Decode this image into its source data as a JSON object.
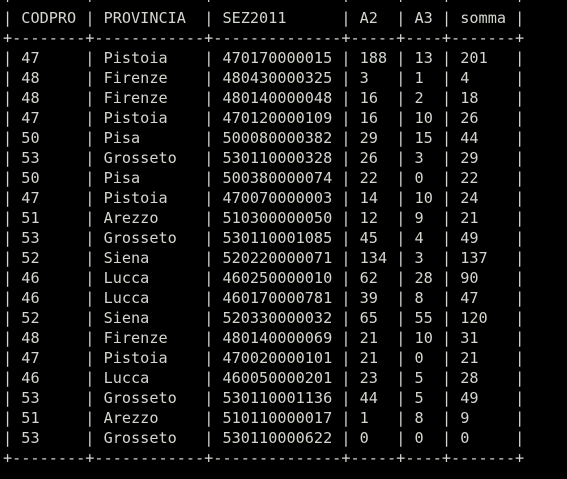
{
  "terminal": {
    "theme": {
      "background": "#000000",
      "foreground": "#d3d7cf"
    },
    "separator": "+--------+------------+--------------+-----+----+-------+",
    "header": [
      "CODPRO",
      "PROVINCIA",
      "SEZ2011",
      "A2",
      "A3",
      "somma"
    ],
    "rows": [
      [
        "47",
        "Pistoia",
        "470170000015",
        "188",
        "13",
        "201"
      ],
      [
        "48",
        "Firenze",
        "480430000325",
        "3",
        "1",
        "4"
      ],
      [
        "48",
        "Firenze",
        "480140000048",
        "16",
        "2",
        "18"
      ],
      [
        "47",
        "Pistoia",
        "470120000109",
        "16",
        "10",
        "26"
      ],
      [
        "50",
        "Pisa",
        "500080000382",
        "29",
        "15",
        "44"
      ],
      [
        "53",
        "Grosseto",
        "530110000328",
        "26",
        "3",
        "29"
      ],
      [
        "50",
        "Pisa",
        "500380000074",
        "22",
        "0",
        "22"
      ],
      [
        "47",
        "Pistoia",
        "470070000003",
        "14",
        "10",
        "24"
      ],
      [
        "51",
        "Arezzo",
        "510300000050",
        "12",
        "9",
        "21"
      ],
      [
        "53",
        "Grosseto",
        "530110001085",
        "45",
        "4",
        "49"
      ],
      [
        "52",
        "Siena",
        "520220000071",
        "134",
        "3",
        "137"
      ],
      [
        "46",
        "Lucca",
        "460250000010",
        "62",
        "28",
        "90"
      ],
      [
        "46",
        "Lucca",
        "460170000781",
        "39",
        "8",
        "47"
      ],
      [
        "52",
        "Siena",
        "520330000032",
        "65",
        "55",
        "120"
      ],
      [
        "48",
        "Firenze",
        "480140000069",
        "21",
        "10",
        "31"
      ],
      [
        "47",
        "Pistoia",
        "470020000101",
        "21",
        "0",
        "21"
      ],
      [
        "46",
        "Lucca",
        "460050000201",
        "23",
        "5",
        "28"
      ],
      [
        "53",
        "Grosseto",
        "530110001136",
        "44",
        "5",
        "49"
      ],
      [
        "51",
        "Arezzo",
        "510110000017",
        "1",
        "8",
        "9"
      ],
      [
        "53",
        "Grosseto",
        "530110000622",
        "0",
        "0",
        "0"
      ]
    ]
  }
}
